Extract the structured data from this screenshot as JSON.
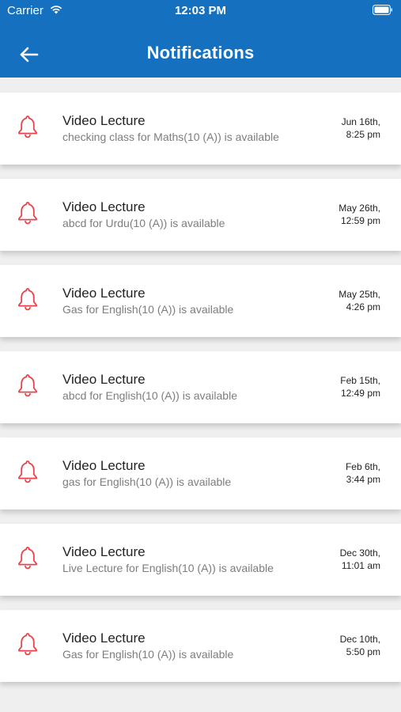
{
  "status_bar": {
    "carrier": "Carrier",
    "time": "12:03 PM"
  },
  "nav": {
    "title": "Notifications",
    "back_icon": "arrow-left-icon"
  },
  "colors": {
    "header_bg": "#1571c0",
    "bell": "#e8424a",
    "background": "#efefef"
  },
  "notifications": [
    {
      "title": "Video Lecture",
      "description": "checking class for Maths(10 (A)) is available",
      "date": "Jun 16th,",
      "time": "8:25 pm"
    },
    {
      "title": "Video Lecture",
      "description": "abcd for Urdu(10 (A)) is available",
      "date": "May 26th,",
      "time": "12:59 pm"
    },
    {
      "title": "Video Lecture",
      "description": "Gas for English(10 (A)) is available",
      "date": "May 25th,",
      "time": "4:26 pm"
    },
    {
      "title": "Video Lecture",
      "description": "abcd for English(10 (A)) is available",
      "date": "Feb 15th,",
      "time": "12:49 pm"
    },
    {
      "title": "Video Lecture",
      "description": "gas for English(10 (A)) is available",
      "date": "Feb 6th,",
      "time": "3:44 pm"
    },
    {
      "title": "Video Lecture",
      "description": "Live Lecture for English(10 (A)) is available",
      "date": "Dec 30th,",
      "time": "11:01 am"
    },
    {
      "title": "Video Lecture",
      "description": "Gas for English(10 (A)) is available",
      "date": "Dec 10th,",
      "time": "5:50 pm"
    }
  ]
}
